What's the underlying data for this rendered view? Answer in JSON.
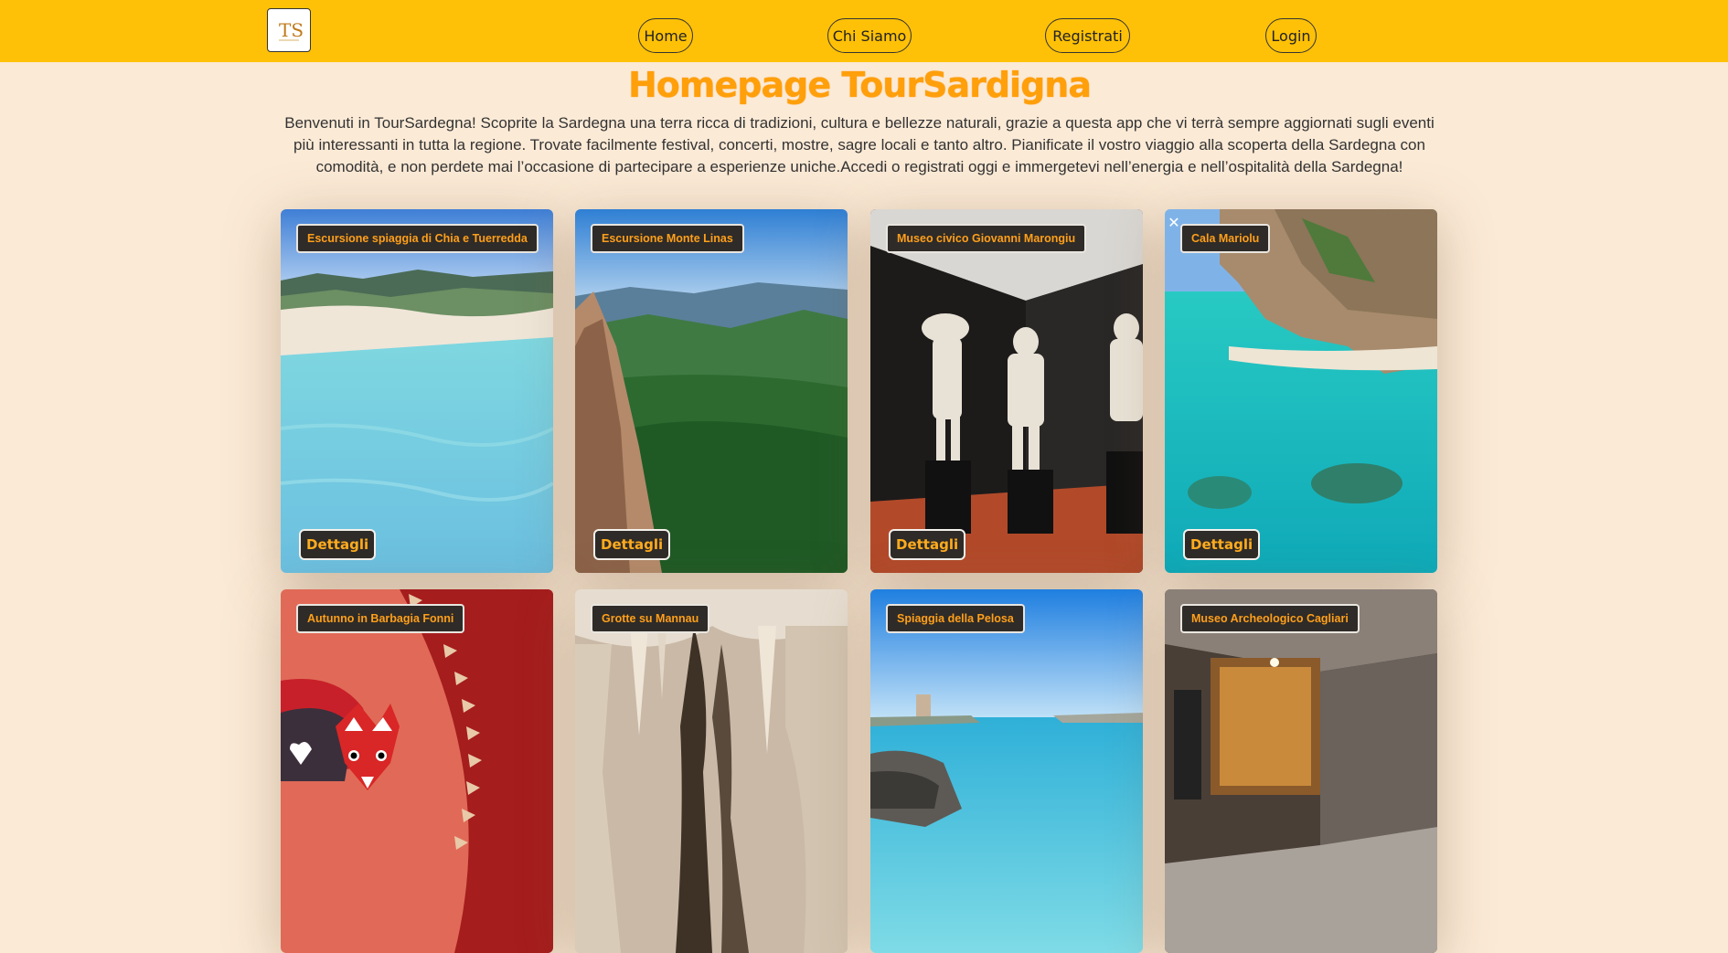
{
  "nav": {
    "logo_text": "TS",
    "items": [
      "Home",
      "Chi Siamo",
      "Registrati",
      "Login"
    ]
  },
  "page_title": "Homepage TourSardigna",
  "intro": "Benvenuti in TourSardegna! Scoprite la Sardegna una terra ricca di tradizioni, cultura e bellezze naturali, grazie a questa app che vi terrà sempre aggiornati sugli eventi più interessanti in tutta la regione. Trovate facilmente festival, concerti, mostre, sagre locali e tanto altro. Pianificate il vostro viaggio alla scoperta della Sardegna con comodità, e non perdete mai l’occasione di partecipare a esperienze uniche.Accedi o registrati oggi e immergetevi nell’energia e nell’ospitalità della Sardegna!",
  "cards": [
    {
      "title": "Escursione spiaggia di Chia e Tuerredda",
      "button": "Dettagli"
    },
    {
      "title": "Escursione Monte Linas",
      "button": "Dettagli"
    },
    {
      "title": "Museo civico Giovanni Marongiu",
      "button": "Dettagli"
    },
    {
      "title": "Cala Mariolu",
      "button": "Dettagli",
      "close_icon": "✕"
    },
    {
      "title": "Autunno in Barbagia Fonni"
    },
    {
      "title": "Grotte su Mannau"
    },
    {
      "title": "Spiaggia della Pelosa"
    },
    {
      "title": "Museo Archeologico Cagliari"
    }
  ],
  "colors": {
    "navbar": "#ffc107",
    "background": "#fbead6",
    "title": "#ff9f0a",
    "badge_bg": "#2e2b28",
    "badge_text": "#ff9f1a"
  }
}
